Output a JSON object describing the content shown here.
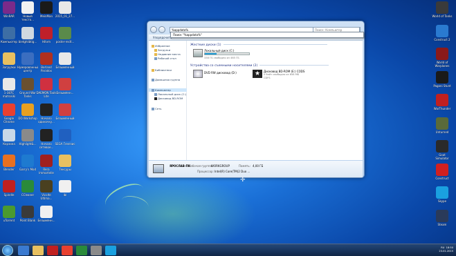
{
  "desktop": {
    "left_icons": [
      {
        "label": "WinRAR",
        "color": "#7a2a8a"
      },
      {
        "label": "Новый тексто...",
        "color": "#f2f2f2"
      },
      {
        "label": "MeinMan",
        "color": "#1a1a1a"
      },
      {
        "label": "2015_01_27...",
        "color": "#e8e8e8"
      },
      {
        "label": "Компьютер",
        "color": "#3d6ea5"
      },
      {
        "label": "bietghlibtig...",
        "color": "#d0d8e0"
      },
      {
        "label": "Hitvm",
        "color": "#c0202a"
      },
      {
        "label": "poster-rectl...",
        "color": "#5a8a4a"
      },
      {
        "label": "Загрузки",
        "color": "#e8c060"
      },
      {
        "label": "Нумерованный центр ВКонтакте",
        "color": "#3b6ec0"
      },
      {
        "label": "Borland Paradox",
        "color": "#b03020"
      },
      {
        "label": "Безымянный",
        "color": "#e8e8e8"
      },
      {
        "label": "1-387С matrosiki",
        "color": "#e8e8e8"
      },
      {
        "label": "Ground War Tanks",
        "color": "#6a5030"
      },
      {
        "label": "DAEMON Tools Lite",
        "color": "#d03040"
      },
      {
        "label": "Безымянн...",
        "color": "#d04040"
      },
      {
        "label": "Google Chrome",
        "color": "#e84030"
      },
      {
        "label": "DO Workshop",
        "color": "#e8a020"
      },
      {
        "label": "Начало одиночку...",
        "color": "#222222"
      },
      {
        "label": "Безымянный",
        "color": "#d04040"
      },
      {
        "label": "Корзина",
        "color": "#c8d8e8"
      },
      {
        "label": "Highlight&...",
        "color": "#8a8a8a"
      },
      {
        "label": "Начало сетевое...",
        "color": "#222222"
      },
      {
        "label": "SEGA Генезис",
        "color": "#2060c0"
      },
      {
        "label": "Blender",
        "color": "#e87020"
      },
      {
        "label": "Garry's Mod",
        "color": "#1e7ad0"
      },
      {
        "label": "Rera Immortelle",
        "color": "#a02020"
      },
      {
        "label": "Тексуры",
        "color": "#e8c060"
      },
      {
        "label": "Spindle",
        "color": "#c02020"
      },
      {
        "label": "CCleaner",
        "color": "#2a8a3a"
      },
      {
        "label": "Vicolte Ultima...",
        "color": "#4a4020"
      },
      {
        "label": "lbl",
        "color": "#f0f0f0"
      },
      {
        "label": "uTorrent",
        "color": "#4a9a30"
      },
      {
        "label": "Point Blank",
        "color": "#3a3a3a"
      },
      {
        "label": "Безымянн...",
        "color": "#f0f0f0"
      }
    ],
    "right_icons": [
      {
        "label": "World of Tanks",
        "color": "#3a3a3a"
      },
      {
        "label": "Construct 2",
        "color": "#2a7ad0"
      },
      {
        "label": "World of Warplanes",
        "color": "#8a1a1a"
      },
      {
        "label": "Pagani Stunt",
        "color": "#1a1a1a"
      },
      {
        "label": "WarThunder",
        "color": "#c02020"
      },
      {
        "label": "Unturned",
        "color": "#5a6a3a"
      },
      {
        "label": "Goat Simulator",
        "color": "#2a2a2a"
      },
      {
        "label": "Construct",
        "color": "#d02020"
      },
      {
        "label": "Skype",
        "color": "#1aa0e0"
      },
      {
        "label": "Steam",
        "color": "#2a3a5a"
      }
    ]
  },
  "explorer": {
    "address": "%appdata%",
    "search_placeholder": "Поиск: Компьютер",
    "autocomplete": "Поиск \"%appdata%\"",
    "organize": "Упорядочить",
    "nav": {
      "favorites": "Избранное",
      "downloads": "Загрузки",
      "recent": "Недавние места",
      "desktop": "Рабочий стол",
      "libraries": "Библиотеки",
      "homegroup": "Домашняя группа",
      "computer": "Компьютер",
      "local_disk": "Локальный диск (C:)",
      "bd_drive": "Дисковод BD-ROM",
      "network": "Сеть"
    },
    "hdd_group": "Жесткие диски (1)",
    "removable_group": "Устройства со съемными носителями (2)",
    "local_disk_name": "Локальный диск (C:)",
    "local_disk_free": "338 ГБ свободно из 465 ГБ",
    "local_disk_used_fraction": 0.27,
    "dvd_name": "DVD RW дисковод (D:)",
    "bd_name": "Дисковод BD-ROM (E:) CODS",
    "bd_free": "0 байт свободно из 658 МБ",
    "bd_fs": "CDFS",
    "details": {
      "computer": "ЯРОСЛАВ-ПК",
      "workgroup_label": "Рабочая группа:",
      "workgroup": "WORKGROUP",
      "memory_label": "Память:",
      "memory": "4,00 ГБ",
      "cpu_label": "Процессор:",
      "cpu": "Intel(R) Core(TM)2 Duo ..."
    }
  },
  "taskbar": {
    "lang": "RU",
    "time": "18:50",
    "date": "23.01.2015",
    "apps": [
      "#3a7ad0",
      "#e8c060",
      "#c02020",
      "#e84030",
      "#2a8a3a",
      "#8a8a8a",
      "#1aa0e0"
    ]
  }
}
